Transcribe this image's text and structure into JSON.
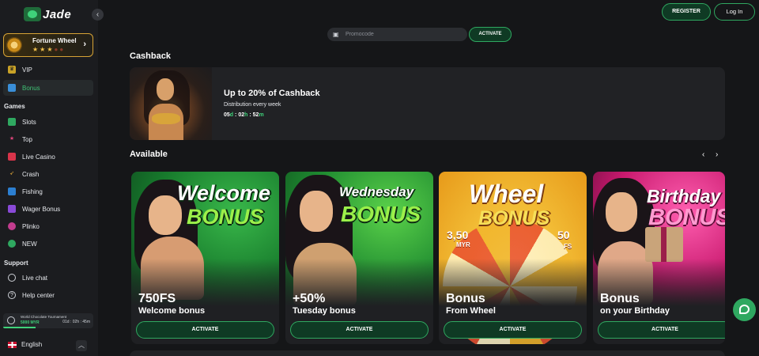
{
  "brand": {
    "logo_text": "Jade"
  },
  "sidebar": {
    "collapse_icon": "chevron-left-icon",
    "fortune_wheel": {
      "title": "Fortune Wheel",
      "stars_filled": 3,
      "stars_total": 5
    },
    "top_items": [
      {
        "label": "VIP",
        "icon": "crown-icon",
        "active": false
      },
      {
        "label": "Bonus",
        "icon": "gift-icon",
        "active": true
      }
    ],
    "games_label": "Games",
    "games": [
      {
        "label": "Slots",
        "icon": "slots-icon"
      },
      {
        "label": "Top",
        "icon": "star-icon"
      },
      {
        "label": "Live Casino",
        "icon": "live-casino-icon"
      },
      {
        "label": "Crash",
        "icon": "rocket-icon"
      },
      {
        "label": "Fishing",
        "icon": "fish-icon"
      },
      {
        "label": "Wager Bonus",
        "icon": "wager-bonus-icon"
      },
      {
        "label": "Plinko",
        "icon": "plinko-icon"
      },
      {
        "label": "NEW",
        "icon": "new-icon"
      }
    ],
    "support_label": "Support",
    "support": [
      {
        "label": "Live chat",
        "icon": "headset-icon"
      },
      {
        "label": "Help center",
        "icon": "help-icon"
      }
    ],
    "tournament": {
      "name": "World Chocolate Tournament",
      "prize": "5000 MYR",
      "time_left": "01d : 02h : 45m",
      "progress": 0.36
    },
    "language": {
      "label": "English",
      "flag": "uk-flag-icon"
    }
  },
  "header": {
    "register_label": "REGISTER",
    "login_label": "Log In",
    "promo_placeholder": "Promocode",
    "promo_button": "ACTIVATE"
  },
  "cashback": {
    "heading": "Cashback",
    "title": "Up to 20% of Cashback",
    "subtitle": "Distribution every week",
    "timer": {
      "days": "05",
      "hours": "02",
      "minutes": "52",
      "d_unit": "d",
      "h_unit": "h",
      "m_unit": "m",
      "sep": ":"
    }
  },
  "available": {
    "heading": "Available",
    "prev_icon": "chevron-left-icon",
    "next_icon": "chevron-right-icon",
    "cards": [
      {
        "banner_1": "Welcome",
        "banner_2": "BONUS",
        "title": "750FS",
        "subtitle": "Welcome bonus",
        "button": "ACTIVATE",
        "theme": "#177a2c"
      },
      {
        "banner_1": "Wednesday",
        "banner_2": "BONUS",
        "title": "+50%",
        "subtitle": "Tuesday bonus",
        "button": "ACTIVATE",
        "theme": "#1e8a30"
      },
      {
        "banner_1": "Wheel",
        "banner_2": "BONUS",
        "wheel_left": "3,50",
        "wheel_left_unit": "MYR",
        "wheel_right": "50",
        "wheel_right_unit": "FS",
        "title": "Bonus",
        "subtitle": "From Wheel",
        "button": "ACTIVATE",
        "theme": "#f4c23a"
      },
      {
        "banner_1": "Birthday",
        "banner_2": "BONUS",
        "title": "Bonus",
        "subtitle": "on your Birthday",
        "button": "ACTIVATE",
        "theme": "#c8196e"
      }
    ]
  },
  "chat_icon": "chat-bubble-icon"
}
